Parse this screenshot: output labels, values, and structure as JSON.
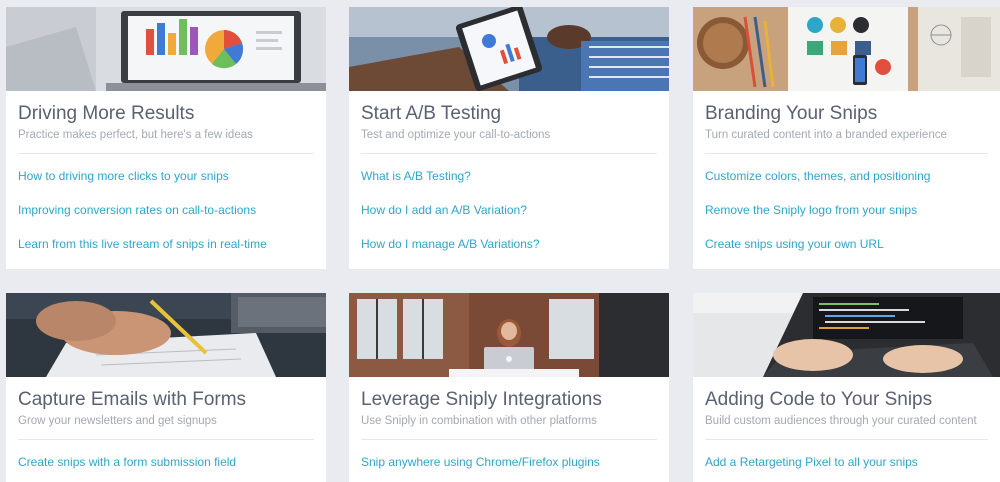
{
  "accent_color": "#2ea6c9",
  "cards": [
    {
      "title": "Driving More Results",
      "subtitle": "Practice makes perfect, but here's a few ideas",
      "image": "laptop-charts-photo",
      "links": [
        "How to driving more clicks to your snips",
        "Improving conversion rates on call-to-actions",
        "Learn from this live stream of snips in real-time"
      ]
    },
    {
      "title": "Start A/B Testing",
      "subtitle": "Test and optimize your call-to-actions",
      "image": "tablet-analytics-photo",
      "links": [
        "What is A/B Testing?",
        "How do I add an A/B Variation?",
        "How do I manage A/B Variations?"
      ]
    },
    {
      "title": "Branding Your Snips",
      "subtitle": "Turn curated content into a branded experience",
      "image": "desk-logos-photo",
      "links": [
        "Customize colors, themes, and positioning",
        "Remove the Sniply logo from your snips",
        "Create snips using your own URL"
      ]
    },
    {
      "title": "Capture Emails with Forms",
      "subtitle": "Grow your newsletters and get signups",
      "image": "hand-writing-photo",
      "links": [
        "Create snips with a form submission field"
      ]
    },
    {
      "title": "Leverage Sniply Integrations",
      "subtitle": "Use Sniply in combination with other platforms",
      "image": "office-laptop-photo",
      "links": [
        "Snip anywhere using Chrome/Firefox plugins"
      ]
    },
    {
      "title": "Adding Code to Your Snips",
      "subtitle": "Build custom audiences through your curated content",
      "image": "keyboard-code-photo",
      "links": [
        "Add a Retargeting Pixel to all your snips"
      ]
    }
  ]
}
